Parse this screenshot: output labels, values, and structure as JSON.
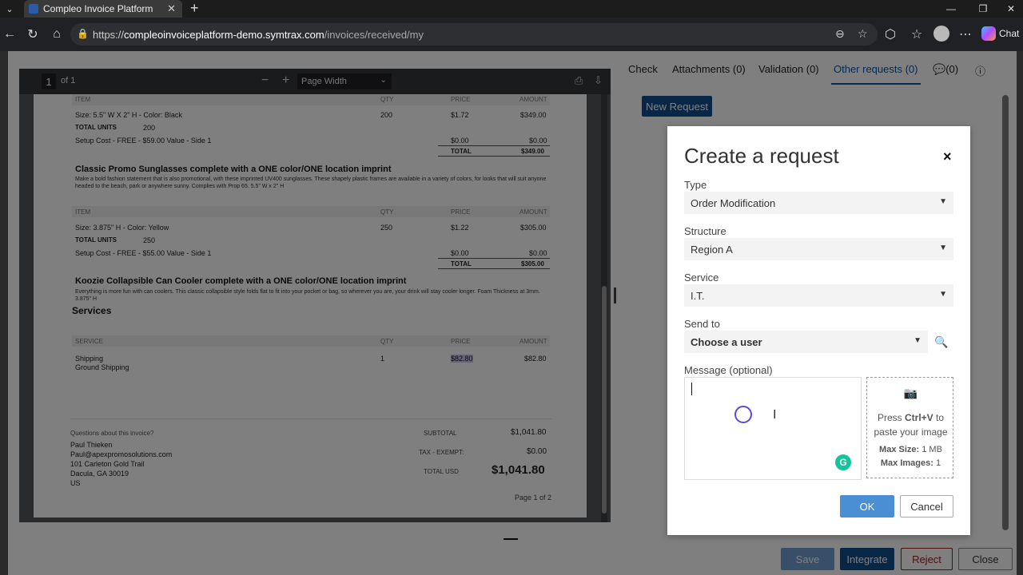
{
  "browser": {
    "tab_title": "Compleo Invoice Platform",
    "url_prefix": "https://",
    "url_host": "compleoinvoiceplatform-demo.symtrax.com",
    "url_path": "/invoices/received/my",
    "chat_label": "Chat"
  },
  "pdf": {
    "page_number": "1",
    "page_of": "of 1",
    "zoom": "Page Width",
    "headers": {
      "item": "ITEM",
      "qty": "QTY",
      "price": "PRICE",
      "amount": "AMOUNT",
      "service": "SERVICE"
    },
    "block1": {
      "size": "Size: 5.5\" W X 2\" H - Color: Black",
      "qty": "200",
      "price": "$1.72",
      "amount": "$349.00",
      "total_units_label": "TOTAL UNITS",
      "total_units": "200",
      "setup": "Setup Cost - FREE - $59.00 Value - Side 1",
      "setup_price": "$0.00",
      "setup_amount": "$0.00",
      "total_label": "TOTAL",
      "total": "$349.00"
    },
    "product2": {
      "title": "Classic Promo Sunglasses complete with a ONE color/ONE location imprint",
      "desc": "Make a bold fashion statement that is also promotional, with these imprinted UV400 sunglasses. These shapely plastic frames are available in a variety of colors, for looks that will suit anyone headed to the beach, park or anywhere sunny. Complies with Prop 65. 5.5\" W x 2\" H"
    },
    "block2": {
      "size": "Size: 3.875\" H - Color: Yellow",
      "qty": "250",
      "price": "$1.22",
      "amount": "$305.00",
      "total_units_label": "TOTAL UNITS",
      "total_units": "250",
      "setup": "Setup Cost - FREE - $55.00 Value - Side 1",
      "setup_price": "$0.00",
      "setup_amount": "$0.00",
      "total_label": "TOTAL",
      "total": "$305.00"
    },
    "product3": {
      "title": "Koozie Collapsible Can Cooler complete with a ONE color/ONE location imprint",
      "desc": "Everything is more fun with can coolers. This classic collapsible style folds flat to fit into your pocket or bag, so wherever you are, your drink will stay cooler longer. Foam Thickness at 3mm. 3.875\" H"
    },
    "services_title": "Services",
    "service_row": {
      "name": "Shipping",
      "sub": "Ground Shipping",
      "qty": "1",
      "price": "$82.80",
      "amount": "$82.80"
    },
    "footer": {
      "questions": "Questions about this invoice?",
      "name": "Paul Thieken",
      "email": "Paul@apexpromosolutions.com",
      "street": "101 Carleton Gold Trail",
      "city": "Dacula, GA 30019",
      "country": "US",
      "subtotal_label": "SUBTOTAL",
      "subtotal": "$1,041.80",
      "tax_label": "TAX - EXEMPT:",
      "tax": "$0.00",
      "total_label": "TOTAL USD",
      "total": "$1,041.80",
      "page": "Page 1 of 2"
    }
  },
  "right_tabs": {
    "check": "Check",
    "attachments": "Attachments (0)",
    "validation": "Validation (0)",
    "other_requests": "Other requests (0)",
    "comments": "(0)"
  },
  "new_request_label": "New Request",
  "modal": {
    "title": "Create a request",
    "close": "×",
    "type_label": "Type",
    "type_value": "Order Modification",
    "structure_label": "Structure",
    "structure_value": "Region A",
    "service_label": "Service",
    "service_value": "I.T.",
    "sendto_label": "Send to",
    "sendto_value": "Choose a user",
    "message_label": "Message (optional)",
    "drop_press": "Press",
    "drop_keys": "Ctrl+V",
    "drop_to": "to",
    "drop_paste": "paste your image",
    "maxsize_label": "Max Size:",
    "maxsize_value": "1 MB",
    "maximages_label": "Max Images:",
    "maximages_value": "1",
    "ok": "OK",
    "cancel": "Cancel"
  },
  "bottom_actions": {
    "save": "Save",
    "integrate": "Integrate",
    "reject": "Reject",
    "close": "Close"
  },
  "colors": {
    "primary": "#114e8c",
    "active_tab": "#0b57a0",
    "ok_button": "#4a8fd4",
    "reject_text": "#a01d1d"
  },
  "icons": [
    "back-icon",
    "refresh-icon",
    "home-icon",
    "lock-icon",
    "star-icon",
    "extensions-icon",
    "favorites-icon",
    "more-icon",
    "print-icon",
    "download-icon",
    "search-icon",
    "camera-icon",
    "grammarly-icon",
    "comment-icon",
    "info-icon"
  ]
}
